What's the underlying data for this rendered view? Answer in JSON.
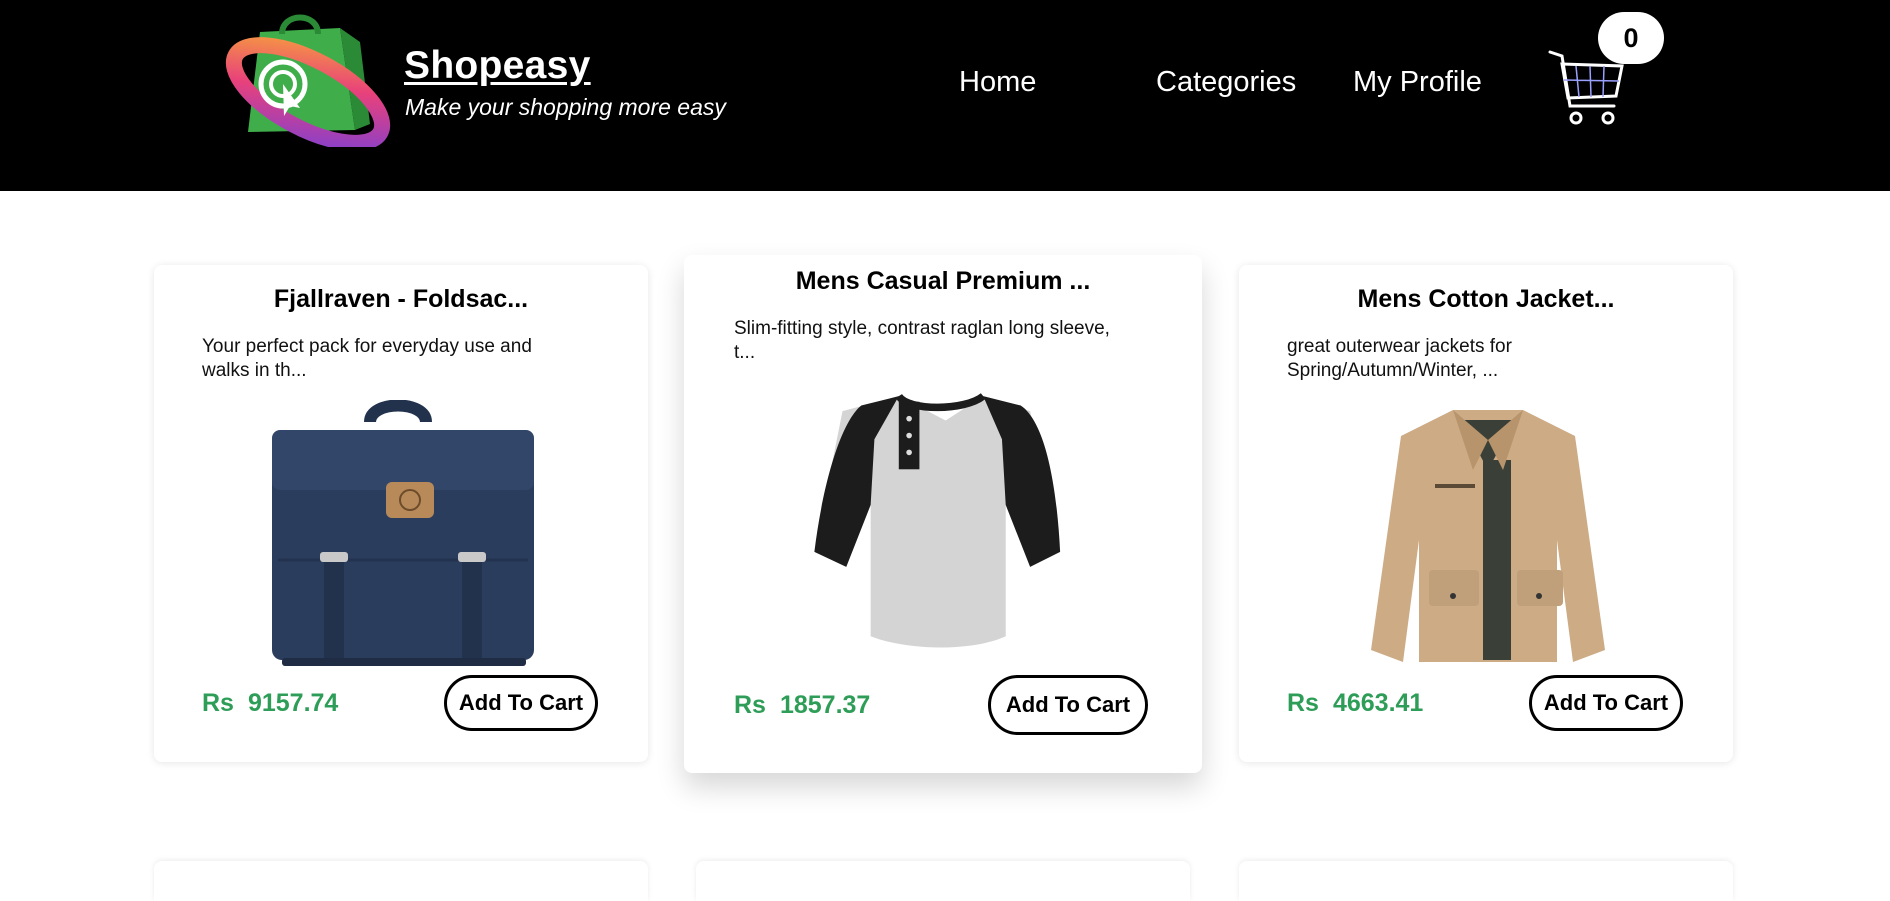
{
  "brand": {
    "name": "Shopeasy",
    "tagline": "Make your shopping more easy"
  },
  "nav": {
    "home": "Home",
    "categories": "Categories",
    "profile": "My Profile"
  },
  "cart": {
    "count": "0"
  },
  "products": [
    {
      "title": "Fjallraven - Foldsac...",
      "description": "Your perfect pack for everyday use and walks in th...",
      "currency": "Rs",
      "price": "9157.74",
      "button": "Add To Cart",
      "image": "backpack-image"
    },
    {
      "title": "Mens Casual Premium ...",
      "description": "Slim-fitting style, contrast raglan long sleeve, t...",
      "currency": "Rs",
      "price": "1857.37",
      "button": "Add To Cart",
      "image": "raglan-tshirt-image"
    },
    {
      "title": "Mens Cotton Jacket...",
      "description": "great outerwear jackets for Spring/Autumn/Winter, ...",
      "currency": "Rs",
      "price": "4663.41",
      "button": "Add To Cart",
      "image": "cotton-jacket-image"
    }
  ],
  "colors": {
    "header_bg": "#000000",
    "price": "#2e9d57",
    "page_bg": "#ffffff"
  }
}
